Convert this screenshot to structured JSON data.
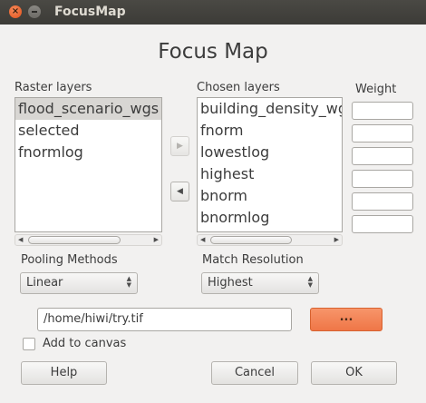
{
  "window": {
    "title": "FocusMap"
  },
  "heading": "Focus Map",
  "raster_layers": {
    "label": "Raster layers",
    "items": [
      "flood_scenario_wgs",
      "selected",
      "fnormlog"
    ],
    "selected_index": 0
  },
  "chosen_layers": {
    "label": "Chosen layers",
    "items": [
      "building_density_wgs",
      "fnorm",
      "lowestlog",
      "highest",
      "bnorm",
      "bnormlog"
    ]
  },
  "weight": {
    "label": "Weight",
    "values": [
      "",
      "",
      "",
      "",
      "",
      ""
    ]
  },
  "transfer": {
    "add_glyph": "▶",
    "remove_glyph": "◀"
  },
  "pooling": {
    "label": "Pooling Methods",
    "value": "Linear"
  },
  "resolution": {
    "label": "Match Resolution",
    "value": "Highest"
  },
  "output": {
    "path": "/home/hiwi/try.tif",
    "browse_label": "..."
  },
  "add_to_canvas": {
    "label": "Add to canvas",
    "checked": false
  },
  "buttons": {
    "help": "Help",
    "cancel": "Cancel",
    "ok": "OK"
  }
}
